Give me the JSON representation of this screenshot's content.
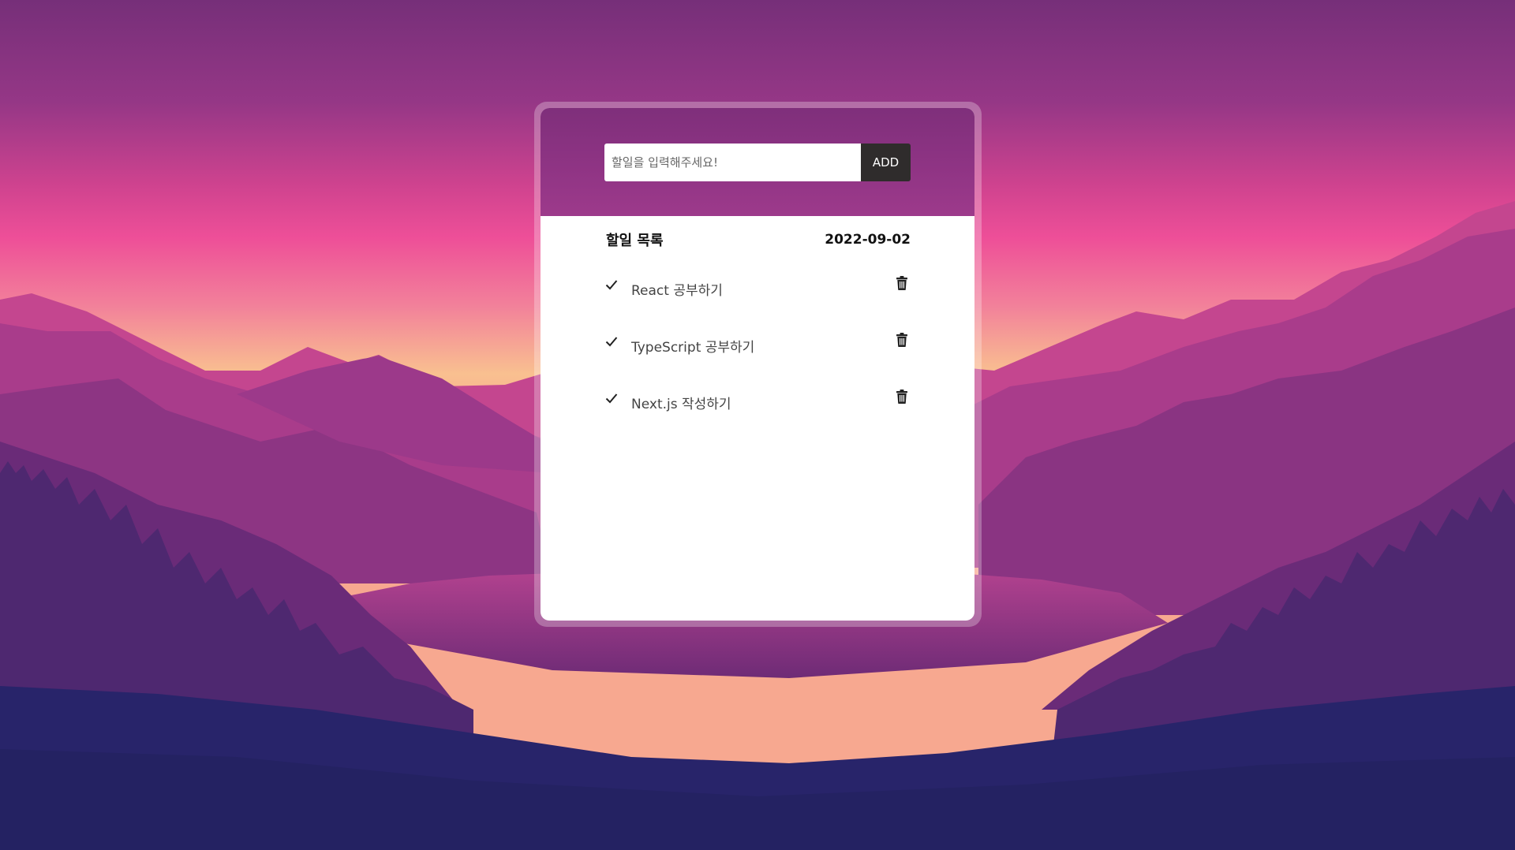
{
  "colors": {
    "sky_top": "#7a2f7a",
    "sky_pink": "#ef4f98",
    "horizon_glow": "#f8c090",
    "card_header": "#8f3484",
    "add_button_bg": "#2f2c2c",
    "deep_valley": "#28246a"
  },
  "todo_app": {
    "input": {
      "placeholder": "할일을 입력해주세요!",
      "value": ""
    },
    "add_button_label": "ADD",
    "list_title": "할일 목록",
    "date": "2022-09-02",
    "items": [
      {
        "text": "React 공부하기",
        "check_icon": "check-icon",
        "delete_icon": "trash-icon"
      },
      {
        "text": "TypeScript 공부하기",
        "check_icon": "check-icon",
        "delete_icon": "trash-icon"
      },
      {
        "text": "Next.js 작성하기",
        "check_icon": "check-icon",
        "delete_icon": "trash-icon"
      }
    ]
  }
}
